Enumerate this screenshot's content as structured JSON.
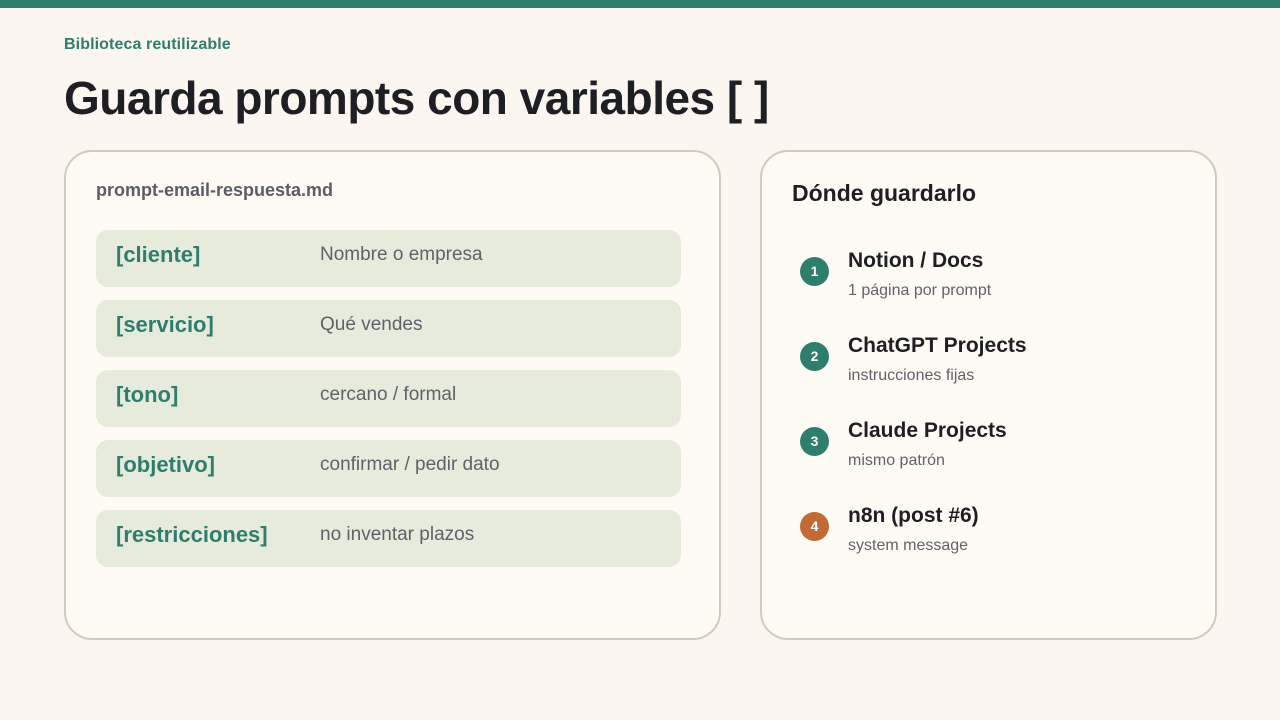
{
  "header": {
    "eyebrow": "Biblioteca reutilizable",
    "title": "Guarda prompts con variables [ ]"
  },
  "template_card": {
    "filename": "prompt-email-respuesta.md",
    "variables": [
      {
        "name": "[cliente]",
        "description": "Nombre o empresa"
      },
      {
        "name": "[servicio]",
        "description": "Qué vendes"
      },
      {
        "name": "[tono]",
        "description": "cercano / formal"
      },
      {
        "name": "[objetivo]",
        "description": "confirmar / pedir dato"
      },
      {
        "name": "[restricciones]",
        "description": "no inventar plazos"
      }
    ]
  },
  "storage_card": {
    "title": "Dónde guardarlo",
    "options": [
      {
        "number": "1",
        "title": "Notion / Docs",
        "subtitle": "1 página por prompt"
      },
      {
        "number": "2",
        "title": "ChatGPT Projects",
        "subtitle": "instrucciones fijas"
      },
      {
        "number": "3",
        "title": "Claude Projects",
        "subtitle": "mismo patrón"
      },
      {
        "number": "4",
        "title": "n8n (post #6)",
        "subtitle": "system message"
      }
    ]
  },
  "colors": {
    "background": "#fbf7f0",
    "accent": "#2f7d6d",
    "highlight": "#c26a35",
    "row_fill": "#e7ebdc"
  }
}
